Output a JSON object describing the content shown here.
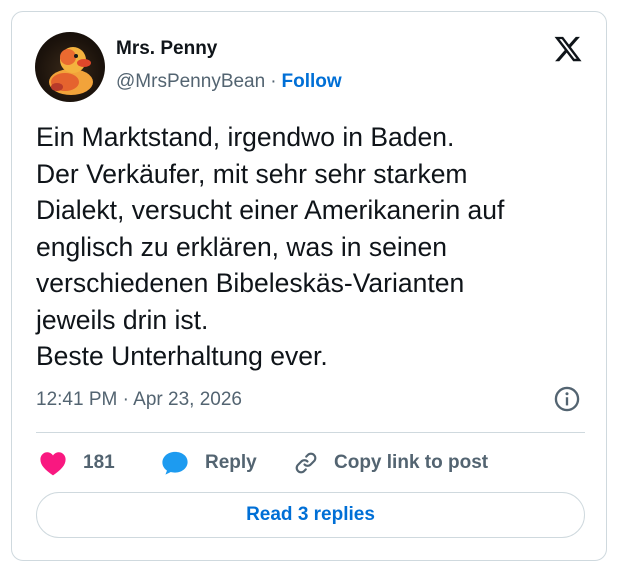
{
  "author": {
    "name": "Mrs. Penny",
    "handle": "@MrsPennyBean",
    "separator": "·",
    "follow_label": "Follow"
  },
  "post": {
    "lines": [
      "Ein Marktstand, irgendwo in Baden.",
      "Der Verkäufer, mit sehr sehr starkem",
      "Dialekt, versucht einer Amerikanerin auf",
      "englisch zu erklären, was in seinen",
      "verschiedenen Bibeleskäs-Varianten",
      "jeweils drin ist.",
      "Beste Unterhaltung ever."
    ],
    "time": "12:41 PM",
    "date_separator": "·",
    "date": "Apr 23, 2026"
  },
  "actions": {
    "like_count": "181",
    "reply_label": "Reply",
    "copy_label": "Copy link to post"
  },
  "footer": {
    "read_replies_label": "Read 3 replies"
  },
  "icons": {
    "brand": "x-logo-icon",
    "info": "info-icon",
    "like": "heart-icon",
    "reply": "speech-bubble-icon",
    "copy": "link-icon",
    "avatar": "rubber-duck-avatar"
  },
  "colors": {
    "link_blue": "#006fd6",
    "like_pink": "#f91880",
    "reply_blue": "#1d9bf0",
    "muted_text": "#536471",
    "border": "#cfd9de"
  }
}
